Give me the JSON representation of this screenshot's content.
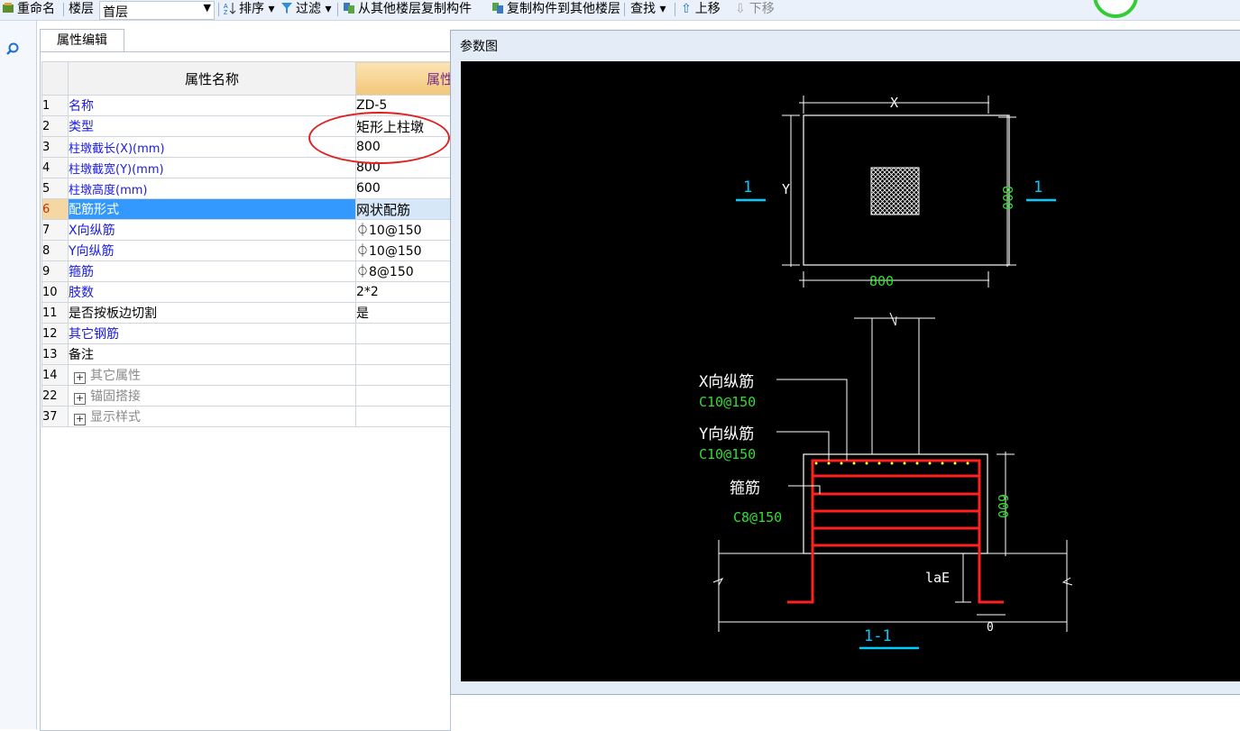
{
  "toolbar": {
    "rename": "重命名",
    "floor_label": "楼层",
    "floor_value": "首层",
    "sort": "排序",
    "filter": "过滤",
    "copy_from": "从其他楼层复制构件",
    "copy_to": "复制构件到其他楼层",
    "find": "查找",
    "move_up": "上移",
    "move_down": "下移"
  },
  "panel": {
    "tab": "属性编辑",
    "col_name": "属性名称",
    "col_value": "属性值"
  },
  "rows": [
    {
      "idx": "1",
      "name": "名称",
      "value": "ZD-5"
    },
    {
      "idx": "2",
      "name": "类型",
      "value": "矩形上柱墩"
    },
    {
      "idx": "3",
      "name": "柱墩截长(X)(mm)",
      "value": "800"
    },
    {
      "idx": "4",
      "name": "柱墩截宽(Y)(mm)",
      "value": "800"
    },
    {
      "idx": "5",
      "name": "柱墩高度(mm)",
      "value": "600"
    },
    {
      "idx": "6",
      "name": "配筋形式",
      "value": "网状配筋"
    },
    {
      "idx": "7",
      "name": "X向纵筋",
      "value": "⏀10@150"
    },
    {
      "idx": "8",
      "name": "Y向纵筋",
      "value": "⏀10@150"
    },
    {
      "idx": "9",
      "name": "箍筋",
      "value": "⏀8@150"
    },
    {
      "idx": "10",
      "name": "肢数",
      "value": "2*2"
    },
    {
      "idx": "11",
      "name": "是否按板边切割",
      "value": "是"
    },
    {
      "idx": "12",
      "name": "其它钢筋",
      "value": ""
    },
    {
      "idx": "13",
      "name": "备注",
      "value": ""
    },
    {
      "idx": "14",
      "name": "其它属性",
      "value": ""
    },
    {
      "idx": "22",
      "name": "锚固搭接",
      "value": ""
    },
    {
      "idx": "37",
      "name": "显示样式",
      "value": ""
    }
  ],
  "diagram": {
    "title": "参数图",
    "dim_x": "X",
    "dim_y": "Y",
    "dim_800_bottom": "800",
    "dim_800_right": "800",
    "section_left": "1",
    "section_right": "1",
    "x_rebar_label": "X向纵筋",
    "x_rebar_value": "C10@150",
    "y_rebar_label": "Y向纵筋",
    "y_rebar_value": "C10@150",
    "stirrup_label": "箍筋",
    "stirrup_value": "C8@150",
    "dim_600": "600",
    "lae": "laE",
    "zero": "0",
    "section_name": "1-1"
  },
  "colors": {
    "selected_row": "#3399ff",
    "link_text": "#1a1ae0",
    "annotation": "#e02020",
    "rebar": "#ff2020",
    "dim_green": "#33dd33",
    "section_cyan": "#00ccff"
  }
}
